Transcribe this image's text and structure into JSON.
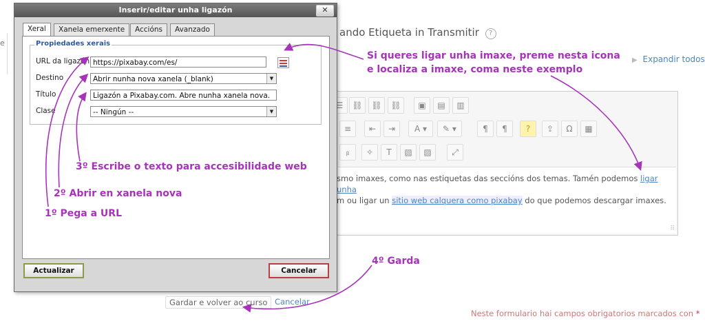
{
  "background": {
    "left_stub_text": "e",
    "page_title": "ando Etiqueta in Transmitir",
    "help_icon": "?",
    "expand_all": "Expandir todos",
    "editor_text": {
      "part1": "smo imaxes, como nas estiquetas das seccións dos temas. Tamén podemos ",
      "link1": "ligar unha",
      "part2": "m ou ligar un ",
      "link2": "sitio web calquera como pixabay",
      "part3": " do que podemos descargar imaxes."
    },
    "save_button": "Gardar e volver ao curso",
    "cancel_link": "Cancelar",
    "required_note": "Neste formulario hai campos obrigatorios marcados con",
    "required_star": "*"
  },
  "dialog": {
    "title": "Inserir/editar unha ligazón",
    "close_label": "✕",
    "tabs": [
      "Xeral",
      "Xanela emerxente",
      "Accións",
      "Avanzado"
    ],
    "legend": "Propiedades xerais",
    "fields": {
      "url_label": "URL da ligazón",
      "url_value": "https://pixabay.com/es/",
      "target_label": "Destino",
      "target_value": "Abrir nunha nova xanela (_blank)",
      "title_label": "Título",
      "title_value": "Ligazón a Pixabay.com. Abre nunha xanela nova.",
      "class_label": "Clase",
      "class_value": "-- Ningún --"
    },
    "update_button": "Actualizar",
    "cancel_button": "Cancelar"
  },
  "annotations": {
    "browse_hint_line1": "Si queres ligar unha imaxe, preme nesta icona",
    "browse_hint_line2": "e localiza a imaxe, coma neste exemplo",
    "step1": "1º Pega a URL",
    "step2": "2º Abrir en xanela nova",
    "step3": "3º Escribe o texto para accesibilidade web",
    "step4": "4º Garda"
  },
  "colors": {
    "annotation": "#a633b9",
    "link": "#4a86c5",
    "legend": "#3059a8"
  },
  "icons": [
    "help-icon",
    "expand-icon",
    "close-icon",
    "browse-icon",
    "dropdown-arrow-icon",
    "resize-grip-icon"
  ]
}
